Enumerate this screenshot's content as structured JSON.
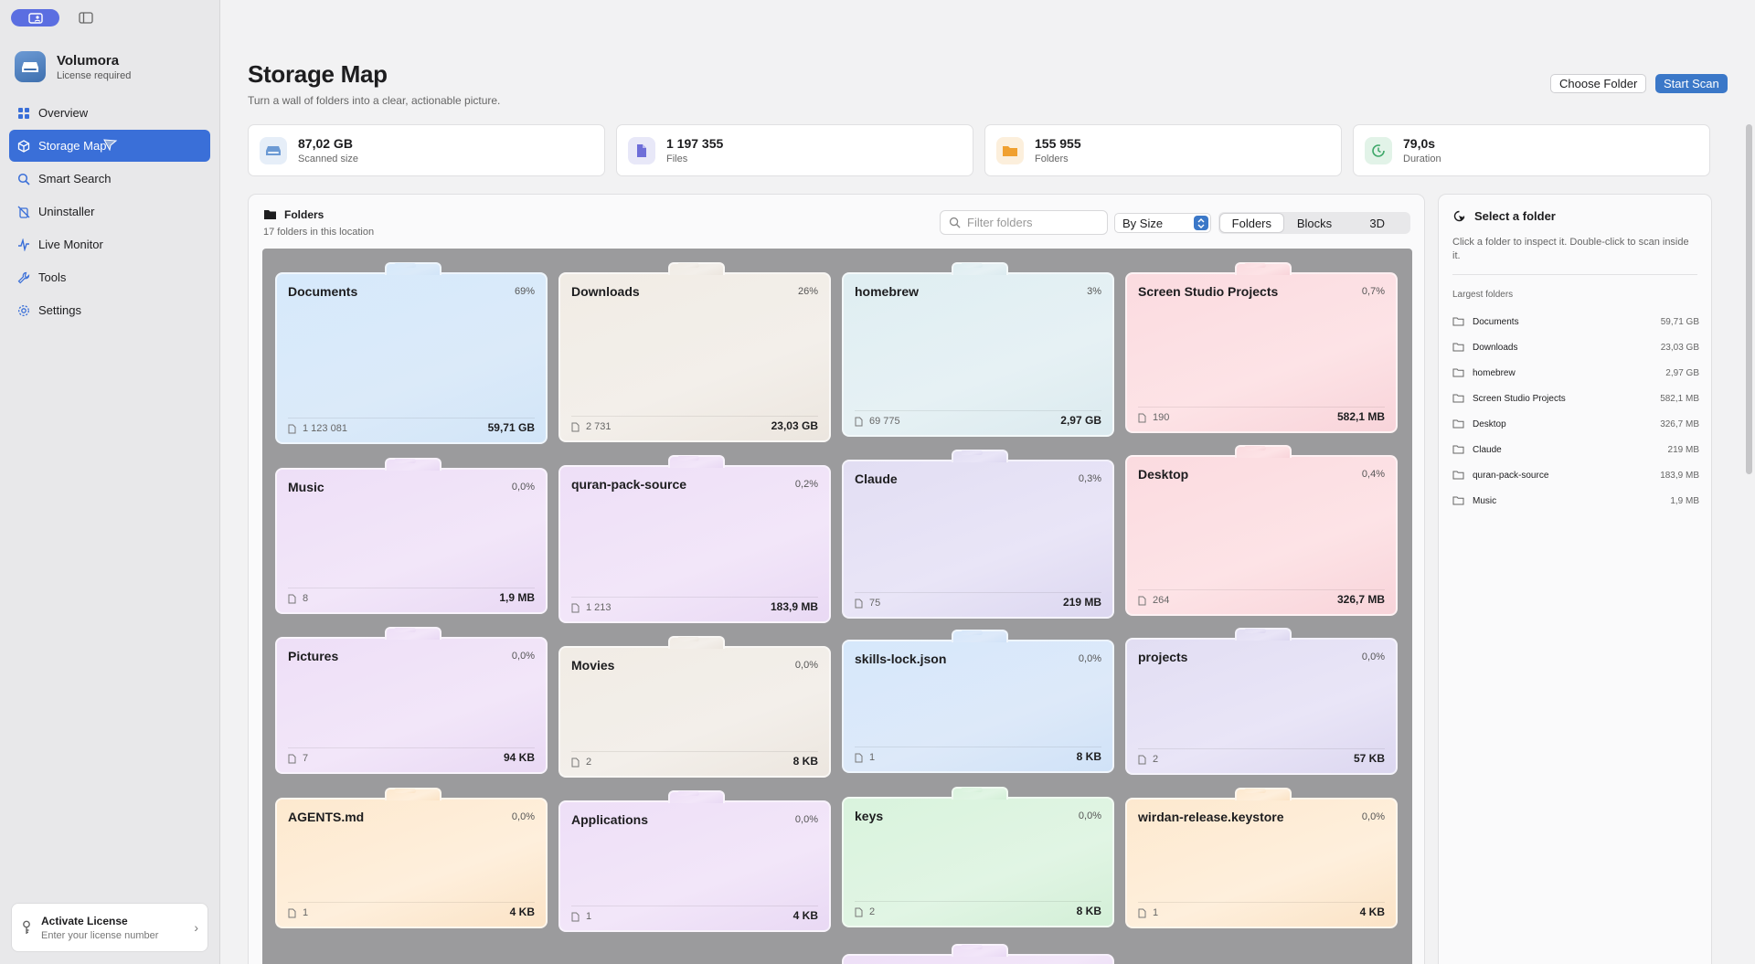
{
  "app": {
    "name": "Volumora",
    "license_status": "License required"
  },
  "sidebar": {
    "items": [
      {
        "label": "Overview",
        "icon": "grid-icon",
        "active": false
      },
      {
        "label": "Storage Map",
        "icon": "cube-icon",
        "active": true
      },
      {
        "label": "Smart Search",
        "icon": "search-icon",
        "active": false
      },
      {
        "label": "Uninstaller",
        "icon": "trash-slash-icon",
        "active": false
      },
      {
        "label": "Live Monitor",
        "icon": "pulse-icon",
        "active": false
      },
      {
        "label": "Tools",
        "icon": "wrench-icon",
        "active": false
      },
      {
        "label": "Settings",
        "icon": "gear-icon",
        "active": false
      }
    ],
    "license_card": {
      "title": "Activate License",
      "subtitle": "Enter your license number"
    }
  },
  "header": {
    "title": "Storage Map",
    "subtitle": "Turn a wall of folders into a clear, actionable picture.",
    "choose_folder_label": "Choose Folder",
    "start_scan_label": "Start Scan"
  },
  "stats": [
    {
      "value": "87,02 GB",
      "label": "Scanned size",
      "icon": "drive-icon",
      "accent": "#6c9ad4"
    },
    {
      "value": "1 197 355",
      "label": "Files",
      "icon": "document-icon",
      "accent": "#6e6ed8"
    },
    {
      "value": "155 955",
      "label": "Folders",
      "icon": "folder-icon",
      "accent": "#f0a030"
    },
    {
      "value": "79,0s",
      "label": "Duration",
      "icon": "timer-icon",
      "accent": "#3fa86a"
    }
  ],
  "folders_panel": {
    "title": "Folders",
    "subtitle": "17 folders in this location",
    "filter_placeholder": "Filter folders",
    "sort_value": "By Size",
    "view_modes": [
      "Folders",
      "Blocks",
      "3D"
    ],
    "active_view": "Folders",
    "cards": [
      {
        "name": "Documents",
        "percent": "69%",
        "count": "1 123 081",
        "size": "59,71 GB",
        "color": "blue"
      },
      {
        "name": "Downloads",
        "percent": "26%",
        "count": "2 731",
        "size": "23,03 GB",
        "color": "beige"
      },
      {
        "name": "homebrew",
        "percent": "3%",
        "count": "69 775",
        "size": "2,97 GB",
        "color": "cyan"
      },
      {
        "name": "Screen Studio Projects",
        "percent": "0,7%",
        "count": "190",
        "size": "582,1 MB",
        "color": "pink"
      },
      {
        "name": "Music",
        "percent": "0,0%",
        "count": "8",
        "size": "1,9 MB",
        "color": "lilac"
      },
      {
        "name": "quran-pack-source",
        "percent": "0,2%",
        "count": "1 213",
        "size": "183,9 MB",
        "color": "lilac"
      },
      {
        "name": "Claude",
        "percent": "0,3%",
        "count": "75",
        "size": "219 MB",
        "color": "lav"
      },
      {
        "name": "Desktop",
        "percent": "0,4%",
        "count": "264",
        "size": "326,7 MB",
        "color": "pink"
      },
      {
        "name": "Pictures",
        "percent": "0,0%",
        "count": "7",
        "size": "94 KB",
        "color": "lilac"
      },
      {
        "name": "Movies",
        "percent": "0,0%",
        "count": "2",
        "size": "8 KB",
        "color": "beige"
      },
      {
        "name": "skills-lock.json",
        "percent": "0,0%",
        "count": "1",
        "size": "8 KB",
        "color": "sky"
      },
      {
        "name": "projects",
        "percent": "0,0%",
        "count": "2",
        "size": "57 KB",
        "color": "lav"
      },
      {
        "name": "AGENTS.md",
        "percent": "0,0%",
        "count": "1",
        "size": "4 KB",
        "color": "peach"
      },
      {
        "name": "Applications",
        "percent": "0,0%",
        "count": "1",
        "size": "4 KB",
        "color": "lilac"
      },
      {
        "name": "keys",
        "percent": "0,0%",
        "count": "2",
        "size": "8 KB",
        "color": "green"
      },
      {
        "name": "wirdan-release.keystore",
        "percent": "0,0%",
        "count": "1",
        "size": "4 KB",
        "color": "peach"
      }
    ]
  },
  "inspector": {
    "title": "Select a folder",
    "description": "Click a folder to inspect it. Double-click to scan inside it.",
    "largest_heading": "Largest folders",
    "largest": [
      {
        "name": "Documents",
        "size": "59,71 GB"
      },
      {
        "name": "Downloads",
        "size": "23,03 GB"
      },
      {
        "name": "homebrew",
        "size": "2,97 GB"
      },
      {
        "name": "Screen Studio Projects",
        "size": "582,1 MB"
      },
      {
        "name": "Desktop",
        "size": "326,7 MB"
      },
      {
        "name": "Claude",
        "size": "219 MB"
      },
      {
        "name": "quran-pack-source",
        "size": "183,9 MB"
      },
      {
        "name": "Music",
        "size": "1,9 MB"
      }
    ]
  }
}
